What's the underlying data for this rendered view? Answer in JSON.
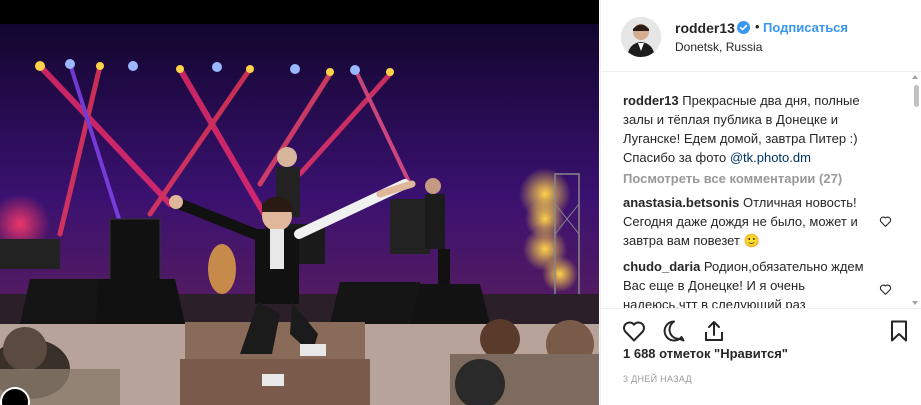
{
  "post": {
    "username": "rodder13",
    "separator": "•",
    "follow_label": "Подписаться",
    "location": "Donetsk, Russia",
    "verified_icon": "verified-badge-icon",
    "accent_color": "#3897f0"
  },
  "caption": {
    "author": "rodder13",
    "text": "Прекрасные два дня, полные залы и тёплая публика в Донецке и Луганске! Едем домой, завтра Питер :) Спасибо за фото",
    "mention": "@tk.photo.dm"
  },
  "view_all_comments": "Посмотреть все комментарии (27)",
  "comments": [
    {
      "author": "anastasia.betsonis",
      "text": "Отличная новость! Сегодня даже дождя не было, может и завтра вам повезет",
      "emoji": "🙂"
    },
    {
      "author": "chudo_daria",
      "text": "Родион,обязательно ждем Вас еще в Донецке! И я очень надеюсь,чтт в следующий раз"
    }
  ],
  "actions": {
    "like_icon": "heart-icon",
    "comment_icon": "comment-icon",
    "share_icon": "share-icon",
    "save_icon": "bookmark-icon"
  },
  "likes": "1 688 отметок \"Нравится\"",
  "timestamp": "3 ДНЕЙ НАЗАД"
}
